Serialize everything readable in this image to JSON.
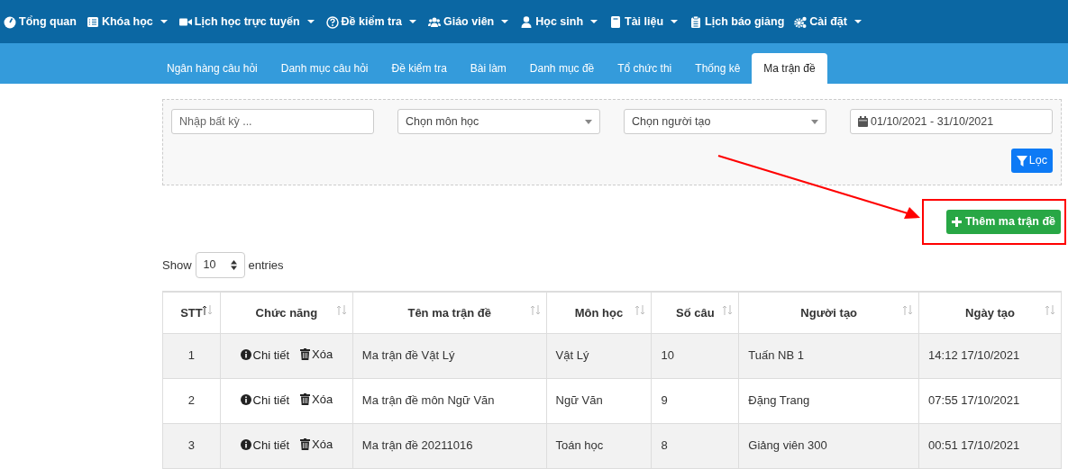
{
  "top_nav": [
    {
      "label": "Tổng quan",
      "has_menu": false
    },
    {
      "label": "Khóa học",
      "has_menu": true
    },
    {
      "label": "Lịch học trực tuyến",
      "has_menu": true
    },
    {
      "label": "Đề kiểm tra",
      "has_menu": true
    },
    {
      "label": "Giáo viên",
      "has_menu": true
    },
    {
      "label": "Học sinh",
      "has_menu": true
    },
    {
      "label": "Tài liệu",
      "has_menu": true
    },
    {
      "label": "Lịch báo giảng",
      "has_menu": false
    },
    {
      "label": "Cài đặt",
      "has_menu": true
    }
  ],
  "tabs": [
    {
      "label": "Ngân hàng câu hỏi",
      "selected": false
    },
    {
      "label": "Danh mục câu hỏi",
      "selected": false
    },
    {
      "label": "Đề kiểm tra",
      "selected": false
    },
    {
      "label": "Bài làm",
      "selected": false
    },
    {
      "label": "Danh mục đề",
      "selected": false
    },
    {
      "label": "Tổ chức thi",
      "selected": false
    },
    {
      "label": "Thống kê",
      "selected": false
    },
    {
      "label": "Ma trận đề",
      "selected": true
    }
  ],
  "filters": {
    "search": {
      "placeholder": "Nhập bất kỳ ..."
    },
    "subject": {
      "value": "Chọn môn học"
    },
    "creator": {
      "value": "Chọn người tạo"
    },
    "date_range": {
      "value": "01/10/2021 - 31/10/2021"
    },
    "filter_button": "Lọc"
  },
  "add_button": "Thêm ma trận đề",
  "page_length": {
    "before": "Show",
    "value": "10",
    "after": "entries"
  },
  "table": {
    "columns": [
      {
        "label": "STT",
        "sorted_ascending": true
      },
      {
        "label": "Chức năng",
        "sorted_ascending": false
      },
      {
        "label": "Tên ma trận đề",
        "sorted_ascending": false
      },
      {
        "label": "Môn học",
        "sorted_ascending": false
      },
      {
        "label": "Số câu",
        "sorted_ascending": false
      },
      {
        "label": "Người tạo",
        "sorted_ascending": false
      },
      {
        "label": "Ngày tạo",
        "sorted_ascending": false
      }
    ],
    "rows": [
      {
        "actions": [
          "Chi tiết",
          "Xóa"
        ],
        "stt": "1",
        "name": "Ma trận đề Vật Lý",
        "subject": "Vật Lý",
        "count": "10",
        "creator": "Tuấn NB 1",
        "created": "14:12 17/10/2021"
      },
      {
        "actions": [
          "Chi tiết",
          "Xóa"
        ],
        "stt": "2",
        "name": "Ma trận đề môn Ngữ Văn",
        "subject": "Ngữ Văn",
        "count": "9",
        "creator": "Đặng Trang",
        "created": "07:55 17/10/2021"
      },
      {
        "actions": [
          "Chi tiết",
          "Xóa"
        ],
        "stt": "3",
        "name": "Ma trận đề 20211016",
        "subject": "Toán học",
        "count": "8",
        "creator": "Giảng viên 300",
        "created": "00:51 17/10/2021"
      }
    ]
  }
}
